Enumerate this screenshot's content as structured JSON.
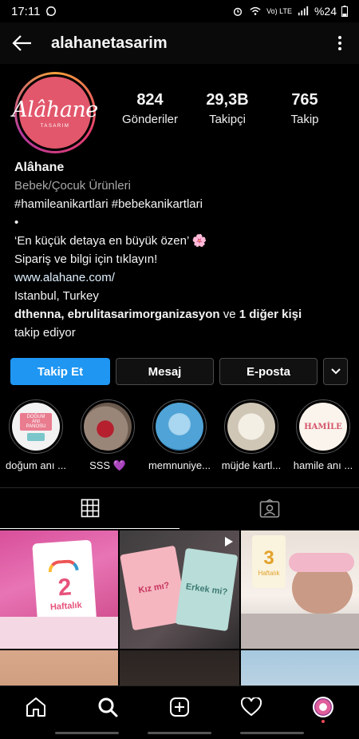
{
  "status": {
    "time": "17:11",
    "battery": "%24",
    "network": "Vo) LTE"
  },
  "header": {
    "username": "alahanetasarim"
  },
  "avatar": {
    "logo": "Alâhane",
    "sub": "TASARIM"
  },
  "stats": [
    {
      "value": "824",
      "label": "Gönderiler"
    },
    {
      "value": "29,3B",
      "label": "Takipçi"
    },
    {
      "value": "765",
      "label": "Takip"
    }
  ],
  "bio": {
    "name": "Alâhane",
    "category": "Bebek/Çocuk Ürünleri",
    "hashtags": "#hamileanikartlari #bebekanikartlari",
    "bullet": "•",
    "line1": "‘En küçük detaya en büyük özen’ 🌸",
    "line2": "Sipariş ve bilgi için tıklayın!",
    "link": "www.alahane.com/",
    "location": "Istanbul, Turkey",
    "followed_names": "dthenna, ebrulitasarimorganizasyon",
    "followed_and": " ve ",
    "followed_more": "1 diğer kişi",
    "followed_suffix": "takip ediyor"
  },
  "buttons": {
    "follow": "Takip Et",
    "message": "Mesaj",
    "email": "E-posta"
  },
  "highlights": [
    {
      "label": "doğum anı ...",
      "art": "DOĞUM ANI PANOSU"
    },
    {
      "label": "SSS 💜",
      "art": ""
    },
    {
      "label": "memnuniye...",
      "art": ""
    },
    {
      "label": "müjde kartl...",
      "art": ""
    },
    {
      "label": "hamile anı ...",
      "art": "HAMİLE"
    }
  ],
  "posts": [
    {
      "number": "2",
      "text": "Haftalık"
    },
    {
      "card1": "Kız mı?",
      "card2": "Erkek mi?"
    },
    {
      "number": "3",
      "text": "Haftalık"
    }
  ],
  "colors": {
    "accent": "#1f96f2",
    "brand": "#e2576b",
    "background": "#000000"
  }
}
